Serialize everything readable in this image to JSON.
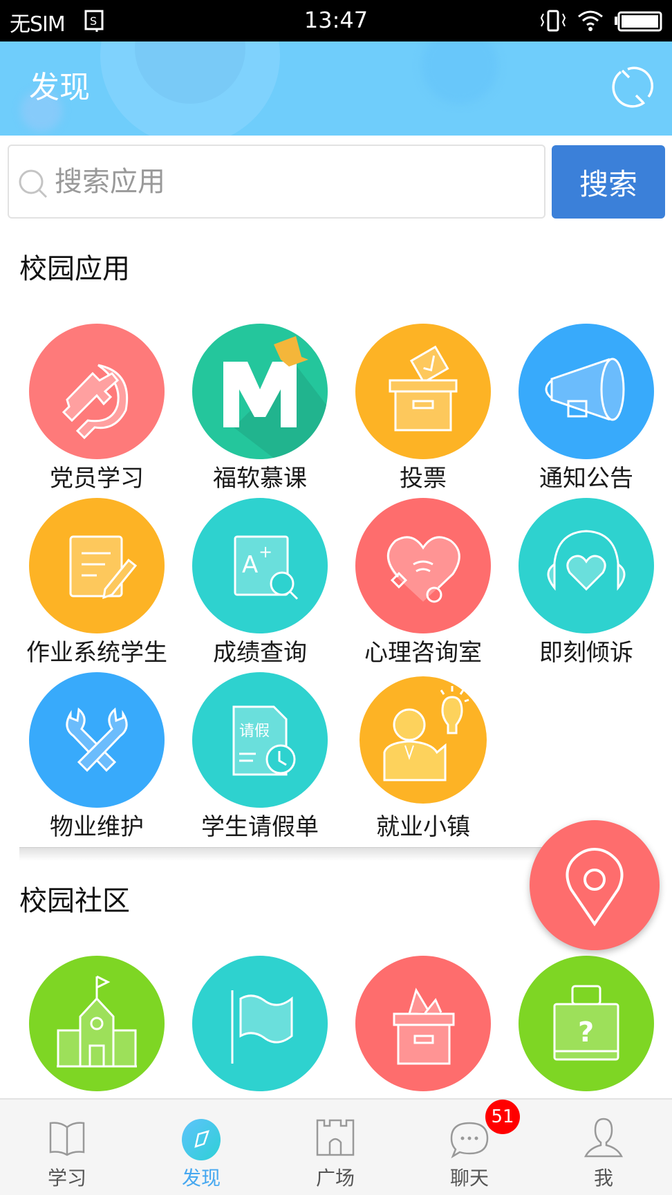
{
  "status_bar": {
    "carrier": "无SIM",
    "time": "13:47",
    "icons": [
      "sim-tray-icon",
      "vibrate-icon",
      "wifi-icon",
      "battery-icon"
    ]
  },
  "header": {
    "title": "发现",
    "refresh_icon": "refresh-icon",
    "background_color": "#6fcdfb"
  },
  "search": {
    "placeholder": "搜索应用",
    "value": "",
    "button_label": "搜索",
    "button_color": "#3b80d9"
  },
  "campus_apps": {
    "title": "校园应用",
    "items": [
      {
        "label": "党员学习",
        "icon": "hammer-sickle-icon",
        "color": "#fe7a7a"
      },
      {
        "label": "福软慕课",
        "icon": "mooc-m-icon",
        "color": "#24c69c"
      },
      {
        "label": "投票",
        "icon": "ballot-box-icon",
        "color": "#fdb325"
      },
      {
        "label": "通知公告",
        "icon": "megaphone-icon",
        "color": "#38aafb"
      },
      {
        "label": "作业系统学生",
        "icon": "homework-edit-icon",
        "color": "#fdb325"
      },
      {
        "label": "成绩查询",
        "icon": "grade-search-icon",
        "color": "#2ed2cf"
      },
      {
        "label": "心理咨询室",
        "icon": "heart-stethoscope-icon",
        "color": "#fe6d6d"
      },
      {
        "label": "即刻倾诉",
        "icon": "headphones-heart-icon",
        "color": "#2ed2cf"
      },
      {
        "label": "物业维护",
        "icon": "wrench-icon",
        "color": "#38aafb"
      },
      {
        "label": "学生请假单",
        "icon": "leave-form-icon",
        "color": "#2ed2cf"
      },
      {
        "label": "就业小镇",
        "icon": "career-idea-icon",
        "color": "#fdb325"
      }
    ],
    "leave_form_text": "请假"
  },
  "campus_community": {
    "title": "校园社区",
    "items": [
      {
        "icon": "school-building-icon",
        "color": "#7ed624"
      },
      {
        "icon": "flag-icon",
        "color": "#2ed2cf"
      },
      {
        "icon": "suggestion-box-icon",
        "color": "#fe6d6d"
      },
      {
        "icon": "lost-found-icon",
        "color": "#7ed624"
      }
    ]
  },
  "fab": {
    "icon": "location-pin-icon",
    "color": "#fe6d6d"
  },
  "tabbar": {
    "items": [
      {
        "label": "学习",
        "icon": "book-icon",
        "active": false
      },
      {
        "label": "发现",
        "icon": "compass-icon",
        "active": true
      },
      {
        "label": "广场",
        "icon": "castle-icon",
        "active": false
      },
      {
        "label": "聊天",
        "icon": "chat-icon",
        "active": false
      },
      {
        "label": "我",
        "icon": "person-icon",
        "active": false
      }
    ],
    "chat_badge": "51"
  }
}
